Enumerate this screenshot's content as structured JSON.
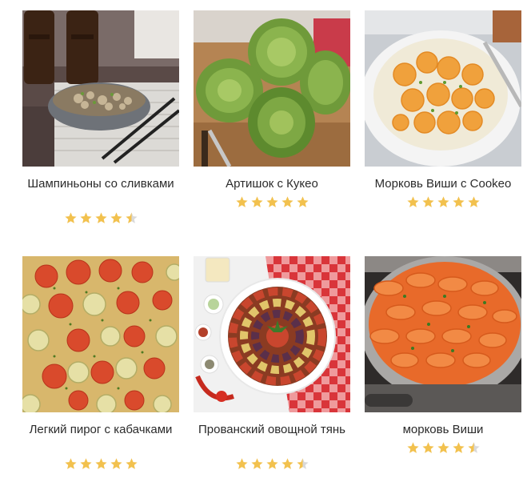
{
  "colors": {
    "star_filled": "#f2c14e",
    "star_empty": "#d9d9d9",
    "title_text": "#2b2b2b"
  },
  "recipes": [
    {
      "title": "Шампиньоны со сливками",
      "rating": 4.5,
      "image_icon": "mushroom-cream-dish-photo"
    },
    {
      "title": "Артишок с Кукео",
      "rating": 5,
      "image_icon": "artichokes-photo"
    },
    {
      "title": "Морковь Виши с Cookeo",
      "rating": 5,
      "image_icon": "vichy-carrots-bowl-photo"
    },
    {
      "title": "Легкий пирог с кабачками",
      "rating": 5,
      "image_icon": "zucchini-tomato-pie-photo"
    },
    {
      "title": "Прованский овощной тянь",
      "rating": 4.5,
      "image_icon": "ratatouille-tian-photo"
    },
    {
      "title": "морковь Виши",
      "rating": 4.5,
      "image_icon": "carrots-pan-photo"
    }
  ]
}
